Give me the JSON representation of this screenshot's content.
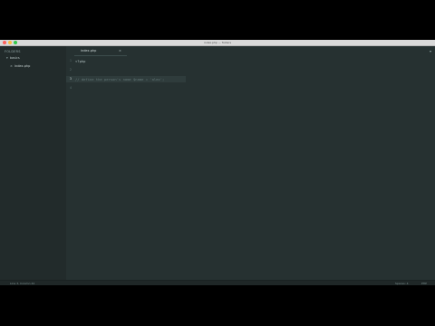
{
  "window": {
    "title": "index.php — folders"
  },
  "sidebar": {
    "header": "FOLDERS",
    "folder": "basics",
    "folder_arrow": "▾",
    "file": {
      "name": "index.php",
      "icon": "close-icon",
      "glyph": "×"
    }
  },
  "tab": {
    "label": "index.php",
    "close_glyph": "×",
    "dropdown_glyph": "▾"
  },
  "editor": {
    "line_numbers": [
      "1",
      "2",
      "3",
      "4"
    ],
    "code": {
      "line1": "<?php",
      "line3_comment": "// define the person's name $name = 'alex';",
      "line3_rest": ""
    }
  },
  "statusbar": {
    "position": "Line 3, Column 42",
    "spaces": "Spaces: 4",
    "syntax": "PHP"
  },
  "colors": {
    "editor_bg": "#263131",
    "sidebar_bg": "#222b2b",
    "titlebar_bg": "#d9d9d9",
    "line_highlight": "#2f3c3c",
    "comment": "#647878"
  }
}
